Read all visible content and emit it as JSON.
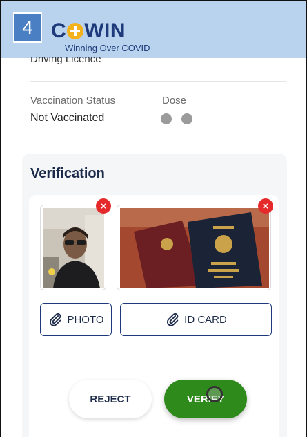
{
  "step": {
    "number": "4"
  },
  "brand": {
    "name_pre": "C",
    "name_post": "WIN",
    "tagline": "Winning Over COVID"
  },
  "id_info": {
    "cut_off_value": "Driving Licence"
  },
  "vaccination": {
    "status_label": "Vaccination Status",
    "status_value": "Not Vaccinated",
    "dose_label": "Dose",
    "doses_taken": 0,
    "doses_total": 2
  },
  "verification": {
    "title": "Verification",
    "photo_button_label": "PHOTO",
    "id_button_label": "ID CARD",
    "remove_symbol": "×"
  },
  "actions": {
    "reject_label": "REJECT",
    "verify_label": "VERIFY"
  },
  "colors": {
    "header_bg": "#b9d3ee",
    "brand_blue": "#1e3a7a",
    "brand_yellow": "#f3b21b",
    "verify_green": "#2f8a1c",
    "remove_red": "#e42a2a",
    "step_badge": "#4a7fc4"
  }
}
